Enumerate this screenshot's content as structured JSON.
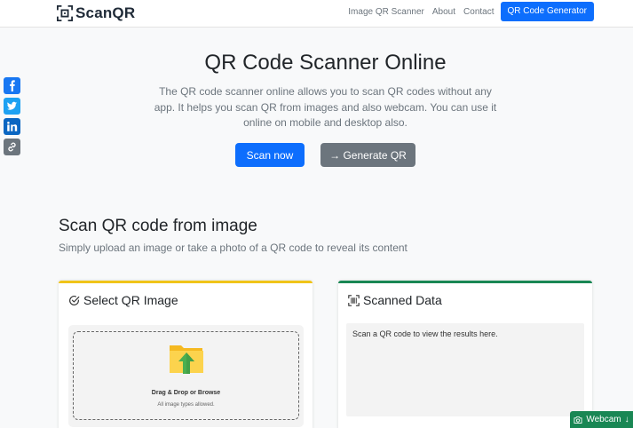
{
  "nav": {
    "brand": "ScanQR",
    "links": [
      "Image QR Scanner",
      "About",
      "Contact"
    ],
    "cta": "QR Code Generator"
  },
  "hero": {
    "title": "QR Code Scanner Online",
    "description": "The QR code scanner online allows you to scan QR codes without any app. It helps you scan QR from images and also webcam. You can use it online on mobile and desktop also.",
    "scan_button": "Scan now",
    "generate_button": "→ Generate QR"
  },
  "section": {
    "title": "Scan QR code from image",
    "subtitle": "Simply upload an image or take a photo of a QR code to reveal its content"
  },
  "select_card": {
    "title": "Select QR Image",
    "drop_title": "Drag & Drop or Browse",
    "drop_sub": "All image types allowed."
  },
  "data_card": {
    "title": "Scanned Data",
    "placeholder": "Scan a QR code to view the results here."
  },
  "webcam": {
    "label": "Webcam",
    "arrow": "↓"
  },
  "colors": {
    "primary": "#0d6efd",
    "secondary": "#6c757d",
    "yellow_accent": "#f0c419",
    "green_accent": "#198754",
    "facebook": "#1877f2",
    "twitter": "#1da1f2",
    "linkedin": "#0a66c2",
    "copy_link": "#6c757d"
  },
  "share_icons": [
    "facebook-icon",
    "twitter-icon",
    "linkedin-icon",
    "link-icon"
  ]
}
